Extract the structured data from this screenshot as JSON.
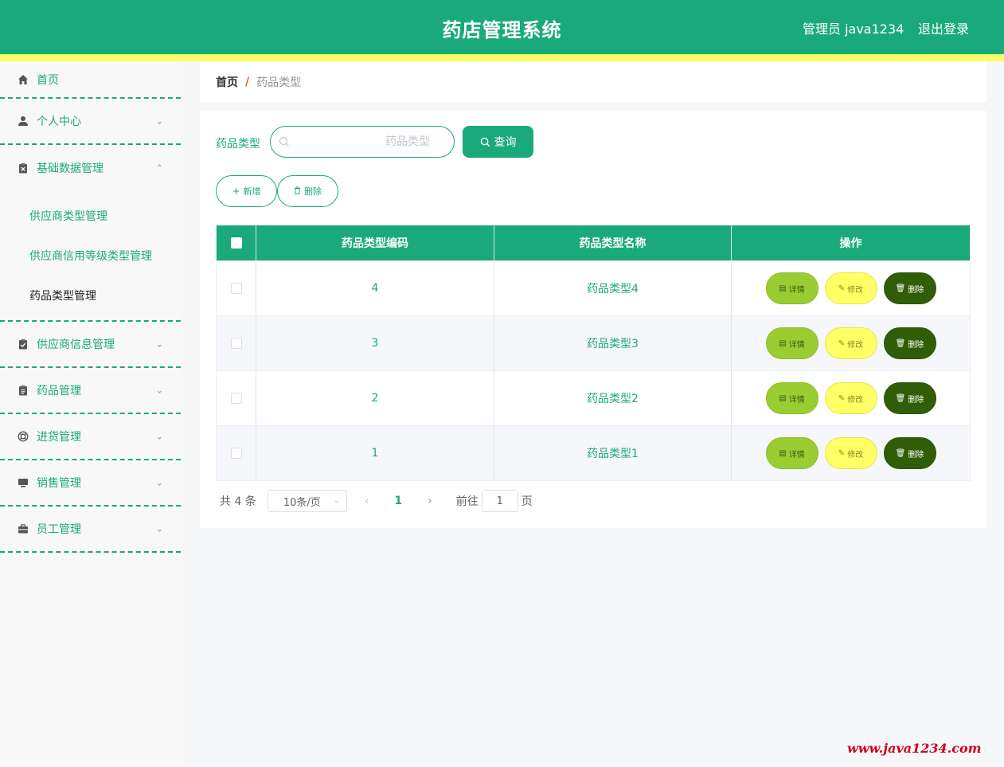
{
  "header": {
    "title": "药店管理系统",
    "admin_text": "管理员 java1234",
    "logout_label": "退出登录",
    "colors": {
      "primary": "#1aa97b",
      "strip": "#fcfb6a"
    }
  },
  "sidebar": {
    "home": {
      "label": "首页",
      "icon": "home-icon"
    },
    "items": [
      {
        "label": "个人中心",
        "icon": "user-icon"
      },
      {
        "label": "基础数据管理",
        "icon": "clipboard-icon"
      },
      {
        "label": "供应商信息管理",
        "icon": "clipboard-check-icon"
      },
      {
        "label": "药品管理",
        "icon": "clipboard-list-icon"
      },
      {
        "label": "进货管理",
        "icon": "lifebuoy-icon"
      },
      {
        "label": "销售管理",
        "icon": "monitor-icon"
      },
      {
        "label": "员工管理",
        "icon": "briefcase-icon"
      }
    ],
    "submenu": [
      {
        "label": "供应商类型管理"
      },
      {
        "label": "供应商信用等级类型管理"
      },
      {
        "label": "药品类型管理"
      }
    ]
  },
  "breadcrumb": {
    "home": "首页",
    "separator": "/",
    "current": "药品类型"
  },
  "search": {
    "label": "药品类型",
    "placeholder": "药品类型",
    "button_label": "查询"
  },
  "actions": {
    "add_label": "新增",
    "delete_label": "删除"
  },
  "table": {
    "headers": [
      "药品类型编码",
      "药品类型名称",
      "操作"
    ],
    "rows": [
      {
        "code": "4",
        "name": "药品类型4"
      },
      {
        "code": "3",
        "name": "药品类型3"
      },
      {
        "code": "2",
        "name": "药品类型2"
      },
      {
        "code": "1",
        "name": "药品类型1"
      }
    ],
    "row_buttons": {
      "detail": "详情",
      "edit": "修改",
      "delete": "删除"
    }
  },
  "pagination": {
    "total_text": "共 4 条",
    "page_size": "10条/页",
    "current_page": "1",
    "goto_label": "前往",
    "jump_value": "1",
    "page_unit": "页"
  },
  "watermark": "www.java1234.com"
}
